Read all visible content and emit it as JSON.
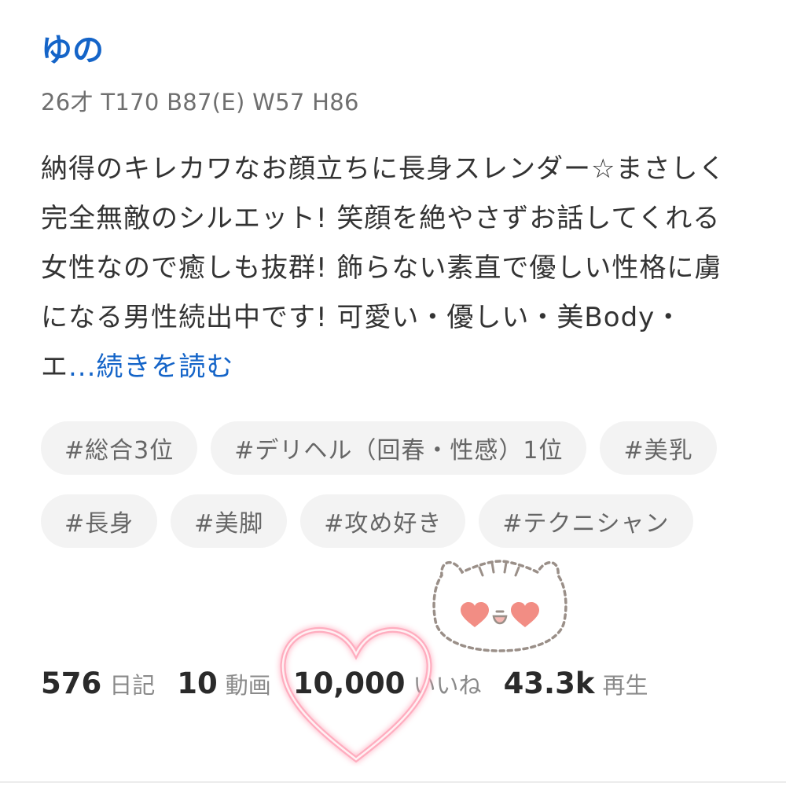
{
  "profile": {
    "name": "ゆの",
    "stats": "26才 T170 B87(E) W57 H86",
    "description": "納得のキレカワなお顔立ちに長身スレンダー☆まさしく完全無敵のシルエット! 笑顔を絶やさずお話してくれる女性なので癒しも抜群! 飾らない素直で優しい性格に虜になる男性続出中です! 可愛い・優しい・美Body・エ",
    "read_more": "...続きを読む"
  },
  "tags": [
    "#総合3位",
    "#デリヘル（回春・性感）1位",
    "#美乳",
    "#長身",
    "#美脚",
    "#攻め好き",
    "#テクニシャン"
  ],
  "counters": {
    "diary": {
      "value": "576",
      "label": "日記"
    },
    "video": {
      "value": "10",
      "label": "動画"
    },
    "likes": {
      "value": "10,000",
      "label": "いいね"
    },
    "plays": {
      "value": "43.3k",
      "label": "再生"
    }
  },
  "decorations": {
    "heart_color": "#ff8fa8",
    "bear_icon": "heart-eyes-bear-sticker"
  }
}
